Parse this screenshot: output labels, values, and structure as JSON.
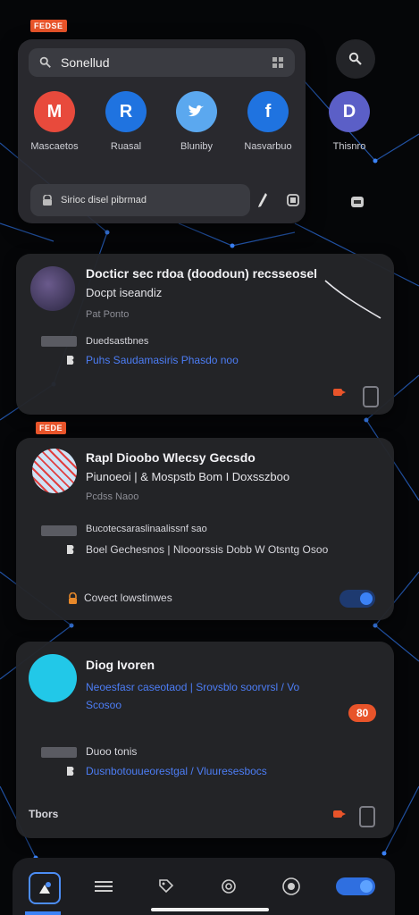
{
  "share_sheet": {
    "tag": "FEDSE",
    "search_label": "Sonellud",
    "services": [
      {
        "name": "Mascaetos",
        "glyph": "M",
        "color": "#e84a3c"
      },
      {
        "name": "Ruasal",
        "glyph": "R",
        "color": "#1f73e0"
      },
      {
        "name": "Bluniby",
        "glyph": "B",
        "color": "#5ba8ef"
      },
      {
        "name": "Nasvarbuo",
        "glyph": "f",
        "color": "#1f73e0"
      },
      {
        "name": "Thisnro",
        "glyph": "D",
        "color": "#5b5fc7"
      }
    ],
    "link_text": "Sirioc disel pibrmad"
  },
  "cards": [
    {
      "title": "Docticr sec rdoa (doodoun) recsseosel",
      "subtitle": "Docpt iseandiz",
      "meta": "Pat Ponto",
      "quote_label": "Duedsastbnes",
      "link": "Puhs Saudamasiris Phasdo noo"
    },
    {
      "tag": "FEDE",
      "title": "Rapl Dioobo  Wlecsy Gecsdo",
      "subtitle": "Piunoeoi | &    Mospstb Bom I   Doxsszboo",
      "meta": "Pcdss Naoo",
      "quote_label": "Bucotecsaraslinaalissnf sao",
      "link": "Boel Gechesnos | Nlooorssis Dobb W Otsntg Osoo",
      "footer": "Covect lowstinwes"
    },
    {
      "title": "Diog Ivoren",
      "link": "Neoesfasr caseotaod | Srovsblo soorvrsl / Vo",
      "link2": "Scosoo",
      "badge": "80",
      "quote_label": "Duoo tonis",
      "quote_link": "Dusnbotouueorestgal / Vluuresesbocs",
      "footer": "Tbors"
    }
  ],
  "colors": {
    "accent": "#e8542a",
    "link": "#4c7df5",
    "toggle": "#2f6fe0"
  }
}
